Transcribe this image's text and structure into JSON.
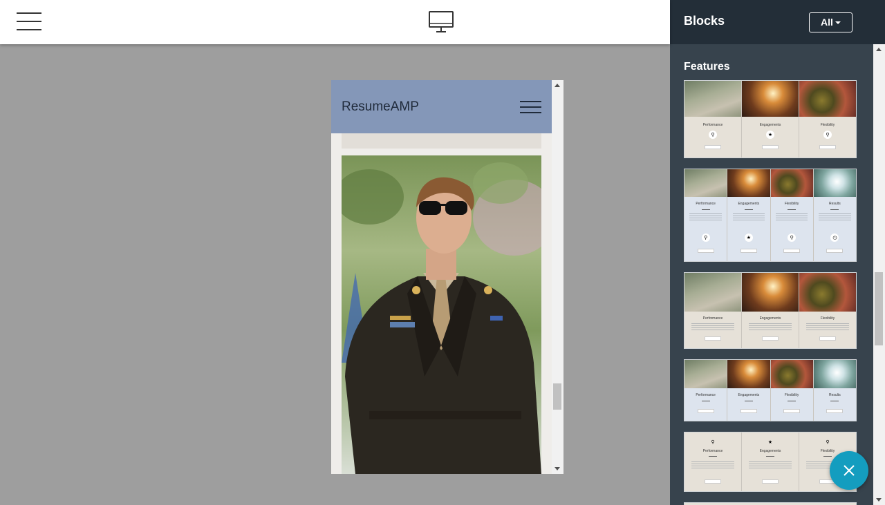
{
  "toolbar": {
    "menu_icon": "hamburger-icon",
    "device_icon": "desktop-monitor-icon"
  },
  "preview": {
    "brand": "ResumeAMP",
    "menu_icon": "hamburger-icon",
    "photo": "man-in-military-uniform-photo"
  },
  "panel": {
    "title": "Blocks",
    "filter_label": "All",
    "section_title": "Features",
    "blocks": [
      {
        "columns": [
          "Performance",
          "Engagements",
          "Flexibility"
        ]
      },
      {
        "columns": [
          "Performance",
          "Engagements",
          "Flexibility",
          "Results"
        ]
      },
      {
        "columns": [
          "Performance",
          "Engagements",
          "Flexibility"
        ]
      },
      {
        "columns": [
          "Performance",
          "Engagements",
          "Flexibility",
          "Results"
        ]
      },
      {
        "columns": [
          "Performance",
          "Engagements",
          "Flexibility"
        ]
      }
    ]
  },
  "fab": {
    "icon": "close-icon"
  },
  "colors": {
    "panel_bg": "#37434d",
    "panel_header_bg": "#232e38",
    "preview_nav_bg": "#8497b8",
    "fab_bg": "#149dbf"
  }
}
